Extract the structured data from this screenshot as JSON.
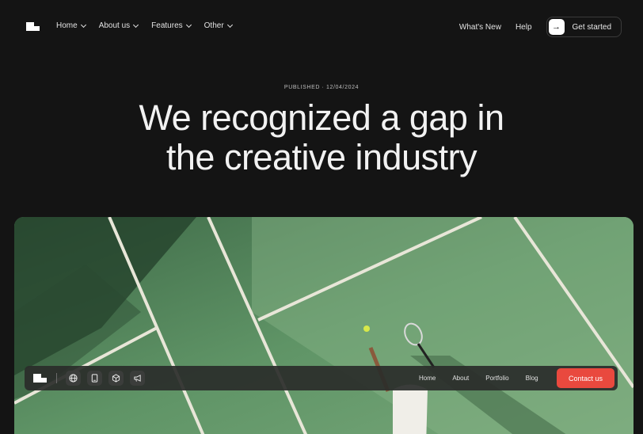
{
  "nav": {
    "items": [
      {
        "label": "Home"
      },
      {
        "label": "About us"
      },
      {
        "label": "Features"
      },
      {
        "label": "Other"
      }
    ],
    "whats_new": "What's New",
    "help": "Help",
    "cta_label": "Get started"
  },
  "article": {
    "published": "PUBLISHED · 12/04/2024",
    "headline_line1": "We recognized a gap in",
    "headline_line2": "the creative industry"
  },
  "dock": {
    "links": [
      "Home",
      "About",
      "Portfolio",
      "Blog"
    ],
    "contact_label": "Contact us",
    "icons": [
      "globe-icon",
      "tablet-icon",
      "cube-icon",
      "megaphone-icon"
    ]
  },
  "colors": {
    "background": "#141414",
    "court": "#6b9b70",
    "accent": "#e9493e"
  }
}
